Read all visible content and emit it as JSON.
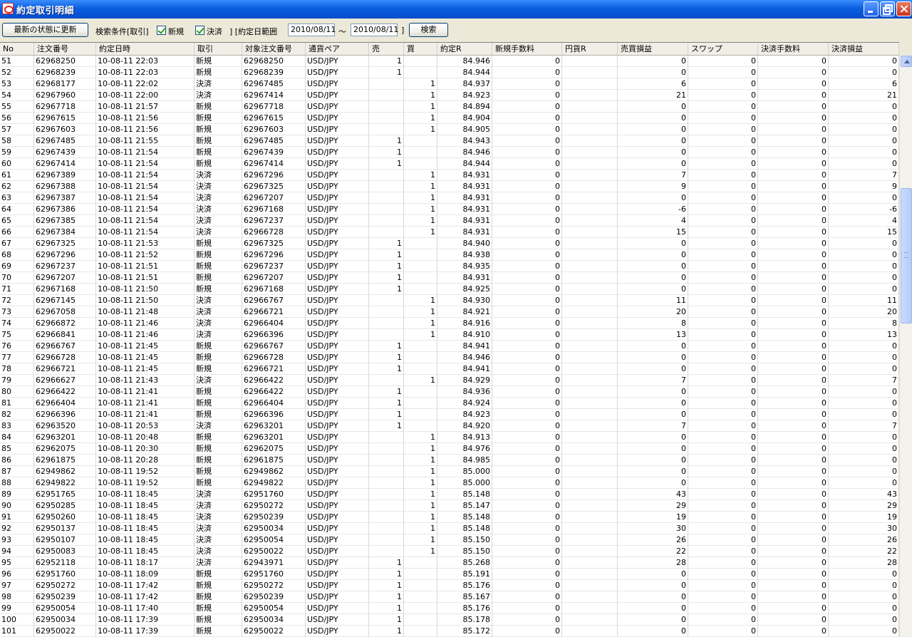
{
  "window": {
    "title": "約定取引明細"
  },
  "toolbar": {
    "refresh_label": "最新の状態に更新",
    "search_condition_label": "検索条件[取引]",
    "new_label": "新規",
    "new_checked": true,
    "settle_label": "決済",
    "settle_checked": true,
    "range_label": "] [約定日範囲",
    "date_from": "2010/08/11",
    "tilde": "～",
    "date_to": "2010/08/11",
    "range_close": "]",
    "search_label": "検索"
  },
  "table": {
    "columns": [
      "No",
      "注文番号",
      "約定日時",
      "取引",
      "対象注文番号",
      "通貨ペア",
      "売",
      "買",
      "約定R",
      "新規手数料",
      "円貨R",
      "売買損益",
      "スワップ",
      "決済手数料",
      "決済損益"
    ],
    "rows": [
      [
        "51",
        "62968250",
        "10-08-11 22:03",
        "新規",
        "62968250",
        "USD/JPY",
        "1",
        "",
        "84.946",
        "0",
        "",
        "0",
        "0",
        "0",
        "0"
      ],
      [
        "52",
        "62968239",
        "10-08-11 22:03",
        "新規",
        "62968239",
        "USD/JPY",
        "1",
        "",
        "84.944",
        "0",
        "",
        "0",
        "0",
        "0",
        "0"
      ],
      [
        "53",
        "62968177",
        "10-08-11 22:02",
        "決済",
        "62967485",
        "USD/JPY",
        "",
        "1",
        "84.937",
        "0",
        "",
        "6",
        "0",
        "0",
        "6"
      ],
      [
        "54",
        "62967960",
        "10-08-11 22:00",
        "決済",
        "62967414",
        "USD/JPY",
        "",
        "1",
        "84.923",
        "0",
        "",
        "21",
        "0",
        "0",
        "21"
      ],
      [
        "55",
        "62967718",
        "10-08-11 21:57",
        "新規",
        "62967718",
        "USD/JPY",
        "",
        "1",
        "84.894",
        "0",
        "",
        "0",
        "0",
        "0",
        "0"
      ],
      [
        "56",
        "62967615",
        "10-08-11 21:56",
        "新規",
        "62967615",
        "USD/JPY",
        "",
        "1",
        "84.904",
        "0",
        "",
        "0",
        "0",
        "0",
        "0"
      ],
      [
        "57",
        "62967603",
        "10-08-11 21:56",
        "新規",
        "62967603",
        "USD/JPY",
        "",
        "1",
        "84.905",
        "0",
        "",
        "0",
        "0",
        "0",
        "0"
      ],
      [
        "58",
        "62967485",
        "10-08-11 21:55",
        "新規",
        "62967485",
        "USD/JPY",
        "1",
        "",
        "84.943",
        "0",
        "",
        "0",
        "0",
        "0",
        "0"
      ],
      [
        "59",
        "62967439",
        "10-08-11 21:54",
        "新規",
        "62967439",
        "USD/JPY",
        "1",
        "",
        "84.946",
        "0",
        "",
        "0",
        "0",
        "0",
        "0"
      ],
      [
        "60",
        "62967414",
        "10-08-11 21:54",
        "新規",
        "62967414",
        "USD/JPY",
        "1",
        "",
        "84.944",
        "0",
        "",
        "0",
        "0",
        "0",
        "0"
      ],
      [
        "61",
        "62967389",
        "10-08-11 21:54",
        "決済",
        "62967296",
        "USD/JPY",
        "",
        "1",
        "84.931",
        "0",
        "",
        "7",
        "0",
        "0",
        "7"
      ],
      [
        "62",
        "62967388",
        "10-08-11 21:54",
        "決済",
        "62967325",
        "USD/JPY",
        "",
        "1",
        "84.931",
        "0",
        "",
        "9",
        "0",
        "0",
        "9"
      ],
      [
        "63",
        "62967387",
        "10-08-11 21:54",
        "決済",
        "62967207",
        "USD/JPY",
        "",
        "1",
        "84.931",
        "0",
        "",
        "0",
        "0",
        "0",
        "0"
      ],
      [
        "64",
        "62967386",
        "10-08-11 21:54",
        "決済",
        "62967168",
        "USD/JPY",
        "",
        "1",
        "84.931",
        "0",
        "",
        "-6",
        "0",
        "0",
        "-6"
      ],
      [
        "65",
        "62967385",
        "10-08-11 21:54",
        "決済",
        "62967237",
        "USD/JPY",
        "",
        "1",
        "84.931",
        "0",
        "",
        "4",
        "0",
        "0",
        "4"
      ],
      [
        "66",
        "62967384",
        "10-08-11 21:54",
        "決済",
        "62966728",
        "USD/JPY",
        "",
        "1",
        "84.931",
        "0",
        "",
        "15",
        "0",
        "0",
        "15"
      ],
      [
        "67",
        "62967325",
        "10-08-11 21:53",
        "新規",
        "62967325",
        "USD/JPY",
        "1",
        "",
        "84.940",
        "0",
        "",
        "0",
        "0",
        "0",
        "0"
      ],
      [
        "68",
        "62967296",
        "10-08-11 21:52",
        "新規",
        "62967296",
        "USD/JPY",
        "1",
        "",
        "84.938",
        "0",
        "",
        "0",
        "0",
        "0",
        "0"
      ],
      [
        "69",
        "62967237",
        "10-08-11 21:51",
        "新規",
        "62967237",
        "USD/JPY",
        "1",
        "",
        "84.935",
        "0",
        "",
        "0",
        "0",
        "0",
        "0"
      ],
      [
        "70",
        "62967207",
        "10-08-11 21:51",
        "新規",
        "62967207",
        "USD/JPY",
        "1",
        "",
        "84.931",
        "0",
        "",
        "0",
        "0",
        "0",
        "0"
      ],
      [
        "71",
        "62967168",
        "10-08-11 21:50",
        "新規",
        "62967168",
        "USD/JPY",
        "1",
        "",
        "84.925",
        "0",
        "",
        "0",
        "0",
        "0",
        "0"
      ],
      [
        "72",
        "62967145",
        "10-08-11 21:50",
        "決済",
        "62966767",
        "USD/JPY",
        "",
        "1",
        "84.930",
        "0",
        "",
        "11",
        "0",
        "0",
        "11"
      ],
      [
        "73",
        "62967058",
        "10-08-11 21:48",
        "決済",
        "62966721",
        "USD/JPY",
        "",
        "1",
        "84.921",
        "0",
        "",
        "20",
        "0",
        "0",
        "20"
      ],
      [
        "74",
        "62966872",
        "10-08-11 21:46",
        "決済",
        "62966404",
        "USD/JPY",
        "",
        "1",
        "84.916",
        "0",
        "",
        "8",
        "0",
        "0",
        "8"
      ],
      [
        "75",
        "62966841",
        "10-08-11 21:46",
        "決済",
        "62966396",
        "USD/JPY",
        "",
        "1",
        "84.910",
        "0",
        "",
        "13",
        "0",
        "0",
        "13"
      ],
      [
        "76",
        "62966767",
        "10-08-11 21:45",
        "新規",
        "62966767",
        "USD/JPY",
        "1",
        "",
        "84.941",
        "0",
        "",
        "0",
        "0",
        "0",
        "0"
      ],
      [
        "77",
        "62966728",
        "10-08-11 21:45",
        "新規",
        "62966728",
        "USD/JPY",
        "1",
        "",
        "84.946",
        "0",
        "",
        "0",
        "0",
        "0",
        "0"
      ],
      [
        "78",
        "62966721",
        "10-08-11 21:45",
        "新規",
        "62966721",
        "USD/JPY",
        "1",
        "",
        "84.941",
        "0",
        "",
        "0",
        "0",
        "0",
        "0"
      ],
      [
        "79",
        "62966627",
        "10-08-11 21:43",
        "決済",
        "62966422",
        "USD/JPY",
        "",
        "1",
        "84.929",
        "0",
        "",
        "7",
        "0",
        "0",
        "7"
      ],
      [
        "80",
        "62966422",
        "10-08-11 21:41",
        "新規",
        "62966422",
        "USD/JPY",
        "1",
        "",
        "84.936",
        "0",
        "",
        "0",
        "0",
        "0",
        "0"
      ],
      [
        "81",
        "62966404",
        "10-08-11 21:41",
        "新規",
        "62966404",
        "USD/JPY",
        "1",
        "",
        "84.924",
        "0",
        "",
        "0",
        "0",
        "0",
        "0"
      ],
      [
        "82",
        "62966396",
        "10-08-11 21:41",
        "新規",
        "62966396",
        "USD/JPY",
        "1",
        "",
        "84.923",
        "0",
        "",
        "0",
        "0",
        "0",
        "0"
      ],
      [
        "83",
        "62963520",
        "10-08-11 20:53",
        "決済",
        "62963201",
        "USD/JPY",
        "1",
        "",
        "84.920",
        "0",
        "",
        "7",
        "0",
        "0",
        "7"
      ],
      [
        "84",
        "62963201",
        "10-08-11 20:48",
        "新規",
        "62963201",
        "USD/JPY",
        "",
        "1",
        "84.913",
        "0",
        "",
        "0",
        "0",
        "0",
        "0"
      ],
      [
        "85",
        "62962075",
        "10-08-11 20:30",
        "新規",
        "62962075",
        "USD/JPY",
        "",
        "1",
        "84.976",
        "0",
        "",
        "0",
        "0",
        "0",
        "0"
      ],
      [
        "86",
        "62961875",
        "10-08-11 20:28",
        "新規",
        "62961875",
        "USD/JPY",
        "",
        "1",
        "84.985",
        "0",
        "",
        "0",
        "0",
        "0",
        "0"
      ],
      [
        "87",
        "62949862",
        "10-08-11 19:52",
        "新規",
        "62949862",
        "USD/JPY",
        "",
        "1",
        "85.000",
        "0",
        "",
        "0",
        "0",
        "0",
        "0"
      ],
      [
        "88",
        "62949822",
        "10-08-11 19:52",
        "新規",
        "62949822",
        "USD/JPY",
        "",
        "1",
        "85.000",
        "0",
        "",
        "0",
        "0",
        "0",
        "0"
      ],
      [
        "89",
        "62951765",
        "10-08-11 18:45",
        "決済",
        "62951760",
        "USD/JPY",
        "",
        "1",
        "85.148",
        "0",
        "",
        "43",
        "0",
        "0",
        "43"
      ],
      [
        "90",
        "62950285",
        "10-08-11 18:45",
        "決済",
        "62950272",
        "USD/JPY",
        "",
        "1",
        "85.147",
        "0",
        "",
        "29",
        "0",
        "0",
        "29"
      ],
      [
        "91",
        "62950260",
        "10-08-11 18:45",
        "決済",
        "62950239",
        "USD/JPY",
        "",
        "1",
        "85.148",
        "0",
        "",
        "19",
        "0",
        "0",
        "19"
      ],
      [
        "92",
        "62950137",
        "10-08-11 18:45",
        "決済",
        "62950034",
        "USD/JPY",
        "",
        "1",
        "85.148",
        "0",
        "",
        "30",
        "0",
        "0",
        "30"
      ],
      [
        "93",
        "62950107",
        "10-08-11 18:45",
        "決済",
        "62950054",
        "USD/JPY",
        "",
        "1",
        "85.150",
        "0",
        "",
        "26",
        "0",
        "0",
        "26"
      ],
      [
        "94",
        "62950083",
        "10-08-11 18:45",
        "決済",
        "62950022",
        "USD/JPY",
        "",
        "1",
        "85.150",
        "0",
        "",
        "22",
        "0",
        "0",
        "22"
      ],
      [
        "95",
        "62952118",
        "10-08-11 18:17",
        "決済",
        "62943971",
        "USD/JPY",
        "1",
        "",
        "85.268",
        "0",
        "",
        "28",
        "0",
        "0",
        "28"
      ],
      [
        "96",
        "62951760",
        "10-08-11 18:09",
        "新規",
        "62951760",
        "USD/JPY",
        "1",
        "",
        "85.191",
        "0",
        "",
        "0",
        "0",
        "0",
        "0"
      ],
      [
        "97",
        "62950272",
        "10-08-11 17:42",
        "新規",
        "62950272",
        "USD/JPY",
        "1",
        "",
        "85.176",
        "0",
        "",
        "0",
        "0",
        "0",
        "0"
      ],
      [
        "98",
        "62950239",
        "10-08-11 17:42",
        "新規",
        "62950239",
        "USD/JPY",
        "1",
        "",
        "85.167",
        "0",
        "",
        "0",
        "0",
        "0",
        "0"
      ],
      [
        "99",
        "62950054",
        "10-08-11 17:40",
        "新規",
        "62950054",
        "USD/JPY",
        "1",
        "",
        "85.176",
        "0",
        "",
        "0",
        "0",
        "0",
        "0"
      ],
      [
        "100",
        "62950034",
        "10-08-11 17:39",
        "新規",
        "62950034",
        "USD/JPY",
        "1",
        "",
        "85.178",
        "0",
        "",
        "0",
        "0",
        "0",
        "0"
      ],
      [
        "101",
        "62950022",
        "10-08-11 17:39",
        "新規",
        "62950022",
        "USD/JPY",
        "1",
        "",
        "85.172",
        "0",
        "",
        "0",
        "0",
        "0",
        "0"
      ]
    ]
  },
  "colors": {
    "title_bar": "#0752d6",
    "grid_background": "#ffffff",
    "window_background": "#ece9d8"
  }
}
